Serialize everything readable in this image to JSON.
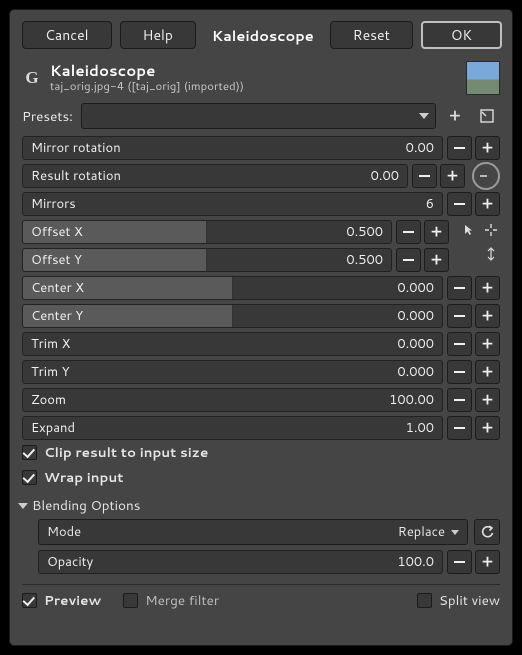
{
  "buttons": {
    "cancel": "Cancel",
    "help": "Help",
    "active": "Kaleidoscope",
    "reset": "Reset",
    "ok": "OK"
  },
  "header": {
    "title": "Kaleidoscope",
    "subtitle": "taj_orig.jpg-4 ([taj_orig] (imported))"
  },
  "presets_label": "Presets:",
  "params": {
    "mirror_rotation": {
      "label": "Mirror rotation",
      "value": "0.00",
      "fill": 0
    },
    "result_rotation": {
      "label": "Result rotation",
      "value": "0.00",
      "fill": 0
    },
    "mirrors": {
      "label": "Mirrors",
      "value": "6",
      "fill": 0
    },
    "offset_x": {
      "label": "Offset X",
      "value": "0.500",
      "fill": 50
    },
    "offset_y": {
      "label": "Offset Y",
      "value": "0.500",
      "fill": 50
    },
    "center_x": {
      "label": "Center X",
      "value": "0.000",
      "fill": 50
    },
    "center_y": {
      "label": "Center Y",
      "value": "0.000",
      "fill": 50
    },
    "trim_x": {
      "label": "Trim X",
      "value": "0.000",
      "fill": 0
    },
    "trim_y": {
      "label": "Trim Y",
      "value": "0.000",
      "fill": 0
    },
    "zoom": {
      "label": "Zoom",
      "value": "100.00",
      "fill": 0
    },
    "expand": {
      "label": "Expand",
      "value": "1.00",
      "fill": 0
    }
  },
  "checks": {
    "clip": "Clip result to input size",
    "wrap": "Wrap input"
  },
  "blending": {
    "section": "Blending Options",
    "mode_label": "Mode",
    "mode_value": "Replace",
    "opacity_label": "Opacity",
    "opacity_value": "100.0"
  },
  "footer": {
    "preview": "Preview",
    "merge": "Merge filter",
    "split": "Split view"
  },
  "icons": {
    "plus": "plus-icon",
    "minus": "minus-icon",
    "save_preset": "save-preset-icon",
    "angle_dial": "angle-dial-icon",
    "pointer": "pointer-icon",
    "center_target": "center-target-icon",
    "expand_dims": "expand-dims-icon",
    "reset_mode": "reset-mode-icon"
  }
}
